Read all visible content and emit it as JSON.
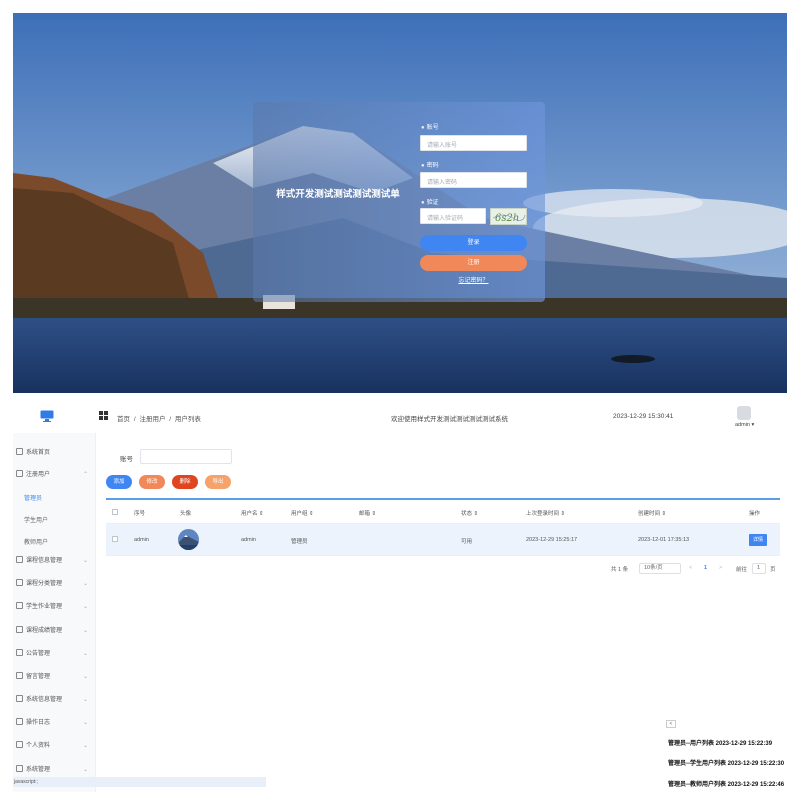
{
  "login": {
    "title": "样式开发测试测试测试测试单",
    "account_label": "账号",
    "account_placeholder": "请输入账号",
    "password_label": "密码",
    "password_placeholder": "请输入密码",
    "captcha_label": "验证",
    "captcha_placeholder": "请输入验证码",
    "captcha_text": "6s2h",
    "login_button": "登录",
    "register_button": "注册",
    "forgot_link": "忘记密码？"
  },
  "topbar": {
    "breadcrumb": [
      "首页",
      "/",
      "注册用户",
      "/",
      "用户列表"
    ],
    "notice": "欢迎使用样式开发测试测试测试测试系统",
    "datetime": "2023-12-29 15:30:41",
    "user": "admin ▾"
  },
  "sidebar": {
    "items": [
      {
        "label": "系统首页"
      },
      {
        "label": "注册用户"
      },
      {
        "label": "管理员"
      },
      {
        "label": "学生用户"
      },
      {
        "label": "教师用户"
      },
      {
        "label": "课程信息管理"
      },
      {
        "label": "课程分类管理"
      },
      {
        "label": "学生作业管理"
      },
      {
        "label": "课程成绩管理"
      },
      {
        "label": "公告管理"
      },
      {
        "label": "留言管理"
      },
      {
        "label": "系统信息管理"
      },
      {
        "label": "操作日志"
      },
      {
        "label": "个人资料"
      },
      {
        "label": "系统管理"
      }
    ]
  },
  "main": {
    "search_label": "账号",
    "buttons": {
      "add": "添加",
      "edit": "修改",
      "delete": "删除",
      "export": "导出"
    },
    "table": {
      "headers": [
        "序号",
        "头像",
        "用户名 ⇕",
        "用户组 ⇕",
        "邮箱 ⇕",
        "状态 ⇕",
        "上次登录时间 ⇕",
        "创建时间 ⇕",
        "操作"
      ],
      "rows": [
        {
          "index": "admin",
          "username": "admin",
          "group": "管理员",
          "email": "",
          "status": "可用",
          "last_login": "2023-12-29 15:25:17",
          "created": "2023-12-01 17:35:13",
          "action": "详情"
        }
      ]
    },
    "pager": {
      "total": "共 1 条",
      "page_size": "10条/页",
      "prev": "<",
      "page": "1",
      "next": ">",
      "goto_label": "前往",
      "goto_value": "1",
      "goto_unit": "页"
    }
  },
  "logs": {
    "toggle": "<",
    "lines": [
      "管理员--用户列表 2023-12-29 15:22:39",
      "管理员--学生用户列表 2023-12-29 15:22:30",
      "管理员--教师用户列表 2023-12-29 15:22:46"
    ]
  },
  "status_bar": "javascript:;"
}
